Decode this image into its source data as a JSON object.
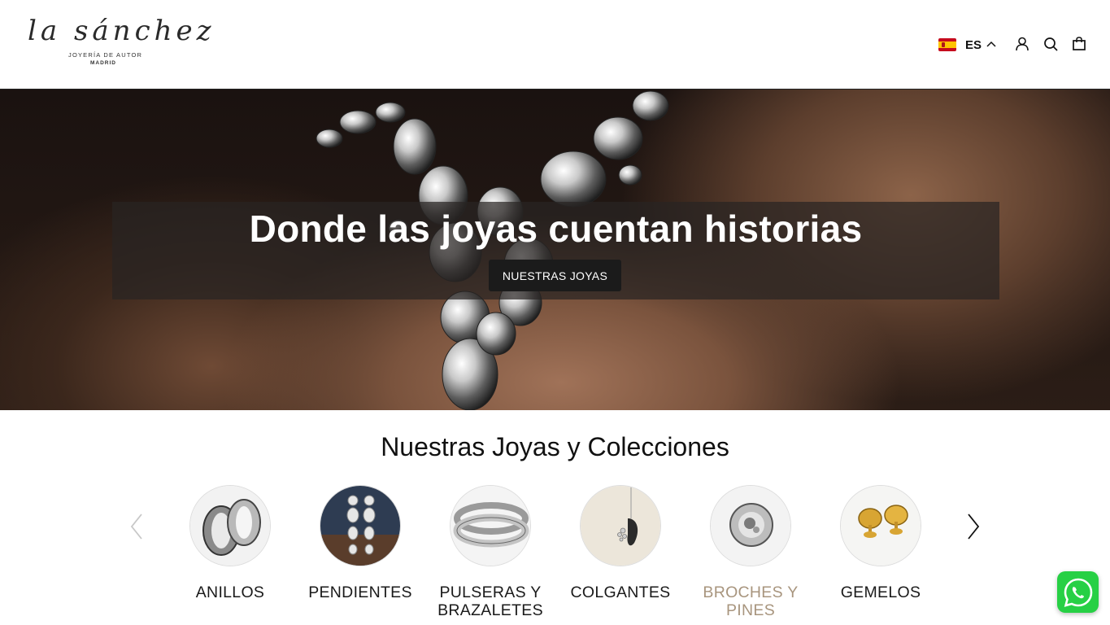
{
  "header": {
    "logo": {
      "script": "la sánchez",
      "subtitle": "JOYERÍA DE AUTOR",
      "city": "MADRID"
    },
    "language": {
      "code": "ES",
      "flag_icon": "spain-flag-icon"
    },
    "icons": [
      "user-icon",
      "search-icon",
      "cart-icon"
    ]
  },
  "hero": {
    "title": "Donde las joyas cuentan historias",
    "button_label": "NUESTRAS JOYAS"
  },
  "collections": {
    "title": "Nuestras Joyas y Colecciones",
    "items": [
      {
        "label": "ANILLOS"
      },
      {
        "label": "PENDIENTES"
      },
      {
        "label": "PULSERAS Y BRAZALETES"
      },
      {
        "label": "COLGANTES"
      },
      {
        "label": "BROCHES Y PINES"
      },
      {
        "label": "GEMELOS"
      }
    ],
    "active_color": "#a8957e"
  },
  "whatsapp": {
    "icon": "whatsapp-icon",
    "color": "#27d045"
  }
}
